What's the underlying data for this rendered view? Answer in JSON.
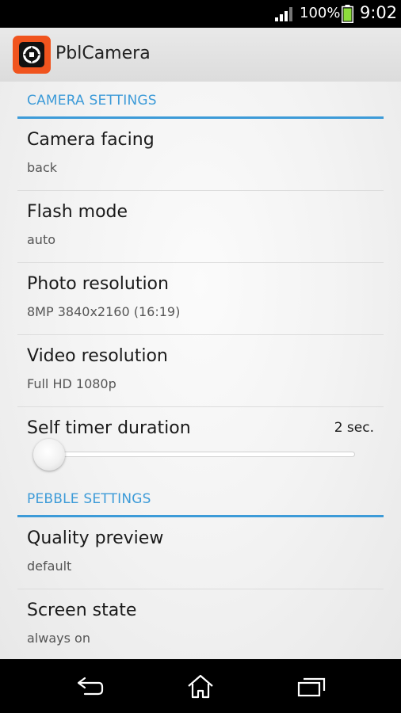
{
  "status_bar": {
    "battery_percent": "100%",
    "time": "9:02",
    "icons": [
      "signal-icon",
      "battery-icon"
    ]
  },
  "action_bar": {
    "app_name": "PblCamera",
    "icon": "app-icon"
  },
  "camera_settings": {
    "header": "CAMERA SETTINGS",
    "items": [
      {
        "title": "Camera facing",
        "summary": "back"
      },
      {
        "title": "Flash mode",
        "summary": "auto"
      },
      {
        "title": "Photo resolution",
        "summary": "8MP 3840x2160 (16:19)"
      },
      {
        "title": "Video resolution",
        "summary": "Full HD 1080p"
      }
    ],
    "self_timer": {
      "title": "Self timer duration",
      "value": "2 sec.",
      "slider_fraction": 0.0
    }
  },
  "pebble_settings": {
    "header": "PEBBLE SETTINGS",
    "items": [
      {
        "title": "Quality preview",
        "summary": "default"
      },
      {
        "title": "Screen state",
        "summary": "always on"
      }
    ]
  },
  "nav_bar": {
    "icons": [
      "back-icon",
      "home-icon",
      "recents-icon"
    ]
  },
  "colors": {
    "accent": "#3d9bd8",
    "app_icon_orange": "#f0541e"
  }
}
